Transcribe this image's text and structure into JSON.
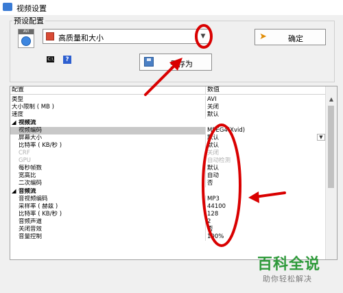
{
  "window": {
    "title": "视频设置"
  },
  "preset": {
    "group_label": "预设配置",
    "file_icon_label": "AVI",
    "selected": "高质量和大小",
    "ok_label": "确定",
    "save_label": "另存为"
  },
  "toolbar": {
    "cmd_icon_label": "C:\\",
    "help_label": "?"
  },
  "grid": {
    "header": {
      "name": "配置",
      "value": "数值"
    },
    "rows": [
      {
        "name": "类型",
        "value": "AVI"
      },
      {
        "name": "大小限制 ( MB )",
        "value": "关闭"
      },
      {
        "name": "速度",
        "value": "默认"
      },
      {
        "name": "视频流"
      },
      {
        "name": "视频编码",
        "value": "MPEG4(Xvid)"
      },
      {
        "name": "屏幕大小",
        "value": "默认"
      },
      {
        "name": "比特率 ( KB/秒 )",
        "value": "默认"
      },
      {
        "name": "CRF",
        "value": "关闭"
      },
      {
        "name": "GPU",
        "value": "自动检测"
      },
      {
        "name": "每秒帧数",
        "value": "默认"
      },
      {
        "name": "宽高比",
        "value": "自动"
      },
      {
        "name": "二次编码",
        "value": "否"
      },
      {
        "name": "音频流"
      },
      {
        "name": "音视频编码",
        "value": "MP3"
      },
      {
        "name": "采样率 ( 赫兹 )",
        "value": "44100"
      },
      {
        "name": "比特率 ( KB/秒 )",
        "value": "128"
      },
      {
        "name": "音频声道",
        "value": "2"
      },
      {
        "name": "关闭音效",
        "value": "否"
      },
      {
        "name": "音量控制",
        "value": "100%"
      }
    ]
  },
  "watermark": {
    "brand": "百科全说",
    "slogan": "助你轻松解决"
  },
  "colors": {
    "annotation": "#d90000",
    "watermark": "#2e9a3a"
  }
}
